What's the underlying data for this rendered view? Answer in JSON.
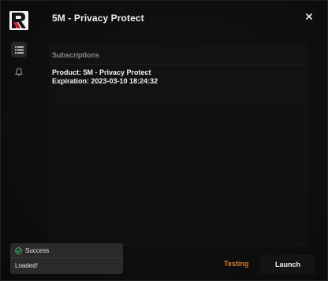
{
  "app": {
    "title": "5M - Privacy Protect"
  },
  "sidebar": {
    "items": [
      {
        "icon": "list-icon",
        "active": true
      },
      {
        "icon": "bell-icon",
        "active": false
      }
    ]
  },
  "main": {
    "section_label": "Subscriptions",
    "product_line": "Product: 5M - Privacy Protect",
    "expiration_line": "Expiration: 2023-03-10 18:24:32"
  },
  "toast": {
    "status": "Success",
    "message": "Loaded!",
    "status_color": "#3ec45a"
  },
  "actions": {
    "testing_label": "Testing",
    "launch_label": "Launch",
    "testing_color": "#d97a2a"
  },
  "colors": {
    "accent_red": "#c81e2e",
    "background": "#0d0d0d"
  }
}
